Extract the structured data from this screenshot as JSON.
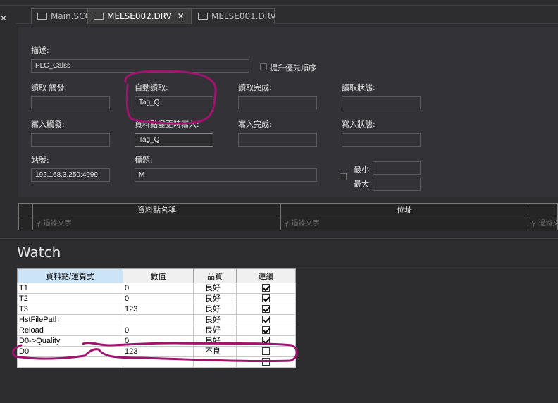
{
  "tabs": [
    {
      "label": "Main.SCC",
      "active": false,
      "closable": false
    },
    {
      "label": "MELSE002.DRV",
      "active": true,
      "closable": true
    },
    {
      "label": "MELSE001.DRV",
      "active": false,
      "closable": false
    }
  ],
  "form": {
    "description_label": "描述:",
    "description_value": "PLC_Calss",
    "priority_label": "提升優先順序",
    "read_trigger_label": "讀取 觸發:",
    "auto_read_label": "自動讀取:",
    "auto_read_value": "Tag_Q",
    "read_complete_label": "讀取完成:",
    "read_status_label": "讀取狀態:",
    "write_trigger_label": "寫入觸發:",
    "write_on_change_label": "資料點變更時寫入:",
    "write_on_change_value": "Tag_Q",
    "write_complete_label": "寫入完成:",
    "write_status_label": "寫入狀態:",
    "station_label": "站號:",
    "station_value": "192.168.3.250:4999",
    "tag_label": "標題:",
    "tag_value": "M",
    "min_label": "最小",
    "max_label": "最大"
  },
  "tag_table": {
    "col_name": "資料點名稱",
    "col_address": "位址",
    "filter_placeholder": "過濾文字"
  },
  "watch": {
    "title": "Watch",
    "headers": [
      "資料點/運算式",
      "數值",
      "品質",
      "連續"
    ],
    "rows": [
      {
        "name": "T1",
        "value": "0",
        "quality": "良好",
        "cont": true
      },
      {
        "name": "T2",
        "value": "0",
        "quality": "良好",
        "cont": true
      },
      {
        "name": "T3",
        "value": "123",
        "quality": "良好",
        "cont": true
      },
      {
        "name": "HstFilePath",
        "value": "",
        "quality": "良好",
        "cont": true
      },
      {
        "name": "Reload",
        "value": "0",
        "quality": "良好",
        "cont": true
      },
      {
        "name": "D0->Quality",
        "value": "0",
        "quality": "良好",
        "cont": true
      },
      {
        "name": "D0",
        "value": "123",
        "quality": "不良",
        "cont": false
      },
      {
        "name": "",
        "value": "",
        "quality": "",
        "cont": false
      }
    ]
  },
  "annotation_color": "#a0136e"
}
